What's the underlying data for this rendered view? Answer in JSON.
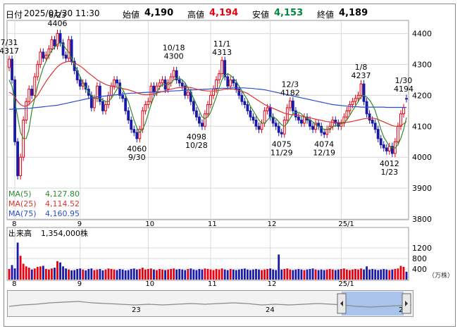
{
  "header": {
    "date_label": "日付",
    "datetime": "2025/01/30 11:30",
    "open_label": "始値",
    "open": "4,190",
    "high_label": "高値",
    "high": "4,194",
    "low_label": "安値",
    "low": "4,153",
    "close_label": "終値",
    "close": "4,189"
  },
  "legend": {
    "ma5_label": "MA(5)",
    "ma5_value": "4,127.80",
    "ma25_label": "MA(25)",
    "ma25_value": "4,114.52",
    "ma75_label": "MA(75)",
    "ma75_value": "4,160.95"
  },
  "volume_panel": {
    "title": "出来高",
    "value": "1,354,000株",
    "unit": "（万株）"
  },
  "navigator": {
    "labels": [
      "23",
      "24",
      "2"
    ]
  },
  "colors": {
    "up": "#e60012",
    "down": "#1a1aa8",
    "ma5": "#2e8b2e",
    "ma25": "#e03030",
    "ma75": "#2a4fd0",
    "grid": "#d9d9d9",
    "nav_selection": "#a9c4ea"
  },
  "chart_data": [
    {
      "type": "candlestick",
      "ylim": [
        3800,
        4440
      ],
      "yticks": [
        "4400",
        "4300",
        "4200",
        "4100",
        "4000",
        "3900",
        "3800"
      ],
      "xticks": [
        "8",
        "9",
        "10",
        "11",
        "12",
        "25/1"
      ],
      "annotations": [
        {
          "date": "7/31",
          "value": "4317"
        },
        {
          "date": "8/23",
          "value": "4406"
        },
        {
          "date": "10/18",
          "value": "4300"
        },
        {
          "date": "11/1",
          "value": "4313"
        },
        {
          "date": "12/3",
          "value": "4182"
        },
        {
          "date": "1/8",
          "value": "4237"
        },
        {
          "date": "1/30",
          "value": "4194"
        },
        {
          "date": "9/30",
          "value": "4060"
        },
        {
          "date": "10/28",
          "value": "4098"
        },
        {
          "date": "11/29",
          "value": "4075"
        },
        {
          "date": "12/19",
          "value": "4074"
        },
        {
          "date": "1/23",
          "value": "4012"
        }
      ],
      "closes": [
        4317,
        4250,
        4050,
        3940,
        4000,
        4120,
        4180,
        4220,
        4200,
        4260,
        4300,
        4340,
        4320,
        4330,
        4350,
        4380,
        4360,
        4400,
        4370,
        4330,
        4320,
        4380,
        4310,
        4280,
        4250,
        4230,
        4240,
        4220,
        4200,
        4160,
        4190,
        4230,
        4180,
        4150,
        4170,
        4200,
        4230,
        4250,
        4240,
        4200,
        4190,
        4150,
        4120,
        4090,
        4080,
        4060,
        4090,
        4150,
        4170,
        4180,
        4230,
        4210,
        4230,
        4240,
        4250,
        4220,
        4240,
        4260,
        4280,
        4250,
        4240,
        4230,
        4200,
        4210,
        4180,
        4150,
        4130,
        4110,
        4100,
        4140,
        4170,
        4200,
        4220,
        4250,
        4270,
        4313,
        4260,
        4230,
        4250,
        4240,
        4220,
        4200,
        4180,
        4170,
        4150,
        4130,
        4120,
        4100,
        4090,
        4110,
        4150,
        4160,
        4130,
        4110,
        4100,
        4080,
        4075,
        4120,
        4160,
        4182,
        4150,
        4130,
        4120,
        4110,
        4130,
        4120,
        4100,
        4090,
        4110,
        4100,
        4080,
        4074,
        4090,
        4100,
        4120,
        4110,
        4100,
        4110,
        4130,
        4150,
        4170,
        4180,
        4190,
        4200,
        4237,
        4180,
        4140,
        4120,
        4110,
        4090,
        4060,
        4040,
        4030,
        4020,
        4035,
        4012,
        4050,
        4100,
        4140,
        4160,
        4189
      ],
      "opens": [
        4290,
        4317,
        4250,
        4050,
        3940,
        4000,
        4120,
        4180,
        4220,
        4200,
        4260,
        4300,
        4340,
        4320,
        4330,
        4350,
        4380,
        4360,
        4400,
        4370,
        4330,
        4320,
        4380,
        4310,
        4280,
        4250,
        4230,
        4240,
        4220,
        4200,
        4160,
        4190,
        4230,
        4180,
        4150,
        4170,
        4200,
        4230,
        4250,
        4240,
        4200,
        4190,
        4150,
        4120,
        4090,
        4080,
        4060,
        4090,
        4150,
        4170,
        4180,
        4230,
        4210,
        4230,
        4240,
        4250,
        4220,
        4240,
        4260,
        4280,
        4250,
        4240,
        4230,
        4200,
        4210,
        4180,
        4150,
        4130,
        4110,
        4100,
        4140,
        4170,
        4200,
        4220,
        4250,
        4270,
        4313,
        4260,
        4230,
        4250,
        4240,
        4220,
        4200,
        4180,
        4170,
        4150,
        4130,
        4120,
        4100,
        4090,
        4110,
        4150,
        4160,
        4130,
        4110,
        4100,
        4080,
        4075,
        4120,
        4160,
        4182,
        4150,
        4130,
        4120,
        4110,
        4130,
        4120,
        4100,
        4090,
        4110,
        4100,
        4080,
        4074,
        4090,
        4100,
        4120,
        4110,
        4100,
        4110,
        4130,
        4150,
        4170,
        4180,
        4190,
        4200,
        4237,
        4180,
        4140,
        4120,
        4110,
        4090,
        4060,
        4040,
        4030,
        4020,
        4035,
        4012,
        4050,
        4100,
        4140,
        4190
      ],
      "ma5": [
        4250,
        4230,
        4180,
        4130,
        4080,
        4060,
        4060,
        4090,
        4150,
        4190,
        4230,
        4260,
        4290,
        4310,
        4330,
        4345,
        4355,
        4365,
        4370,
        4365,
        4350,
        4340,
        4320,
        4300,
        4280,
        4260,
        4240,
        4225,
        4210,
        4200,
        4190,
        4190,
        4190,
        4185,
        4180,
        4180,
        4190,
        4205,
        4220,
        4230,
        4220,
        4200,
        4180,
        4150,
        4120,
        4095,
        4080,
        4090,
        4110,
        4140,
        4170,
        4195,
        4210,
        4225,
        4235,
        4235,
        4235,
        4240,
        4250,
        4255,
        4255,
        4250,
        4240,
        4225,
        4210,
        4190,
        4170,
        4150,
        4130,
        4125,
        4130,
        4145,
        4170,
        4195,
        4225,
        4250,
        4265,
        4270,
        4265,
        4255,
        4245,
        4230,
        4215,
        4200,
        4185,
        4165,
        4150,
        4135,
        4120,
        4110,
        4110,
        4120,
        4130,
        4130,
        4125,
        4115,
        4105,
        4100,
        4110,
        4125,
        4140,
        4145,
        4145,
        4140,
        4130,
        4125,
        4120,
        4115,
        4105,
        4100,
        4095,
        4090,
        4090,
        4092,
        4098,
        4102,
        4105,
        4108,
        4112,
        4120,
        4135,
        4150,
        4165,
        4180,
        4195,
        4200,
        4195,
        4185,
        4170,
        4150,
        4120,
        4090,
        4065,
        4050,
        4035,
        4030,
        4030,
        4040,
        4060,
        4090,
        4128
      ],
      "ma25": [
        4210,
        4205,
        4195,
        4180,
        4170,
        4165,
        4165,
        4170,
        4180,
        4190,
        4200,
        4215,
        4230,
        4245,
        4258,
        4270,
        4282,
        4292,
        4300,
        4305,
        4308,
        4310,
        4308,
        4305,
        4300,
        4295,
        4288,
        4280,
        4272,
        4265,
        4258,
        4250,
        4245,
        4240,
        4235,
        4232,
        4230,
        4228,
        4226,
        4224,
        4222,
        4220,
        4218,
        4215,
        4212,
        4208,
        4205,
        4203,
        4202,
        4202,
        4203,
        4205,
        4207,
        4210,
        4212,
        4215,
        4218,
        4220,
        4222,
        4224,
        4225,
        4226,
        4226,
        4226,
        4225,
        4223,
        4220,
        4218,
        4216,
        4215,
        4214,
        4214,
        4214,
        4215,
        4216,
        4218,
        4220,
        4221,
        4221,
        4220,
        4218,
        4216,
        4213,
        4210,
        4206,
        4200,
        4194,
        4188,
        4182,
        4176,
        4170,
        4166,
        4162,
        4158,
        4154,
        4150,
        4146,
        4142,
        4140,
        4138,
        4137,
        4136,
        4135,
        4133,
        4131,
        4129,
        4127,
        4125,
        4123,
        4121,
        4119,
        4117,
        4115,
        4114,
        4113,
        4112,
        4112,
        4112,
        4112,
        4113,
        4114,
        4116,
        4118,
        4120,
        4122,
        4124,
        4125,
        4126,
        4126,
        4125,
        4122,
        4118,
        4114,
        4110,
        4106,
        4102,
        4100,
        4100,
        4102,
        4108,
        4115
      ],
      "ma75": [
        4155,
        4155,
        4156,
        4156,
        4157,
        4157,
        4158,
        4158,
        4159,
        4160,
        4161,
        4162,
        4163,
        4164,
        4165,
        4166,
        4167,
        4168,
        4170,
        4172,
        4174,
        4176,
        4178,
        4180,
        4182,
        4184,
        4186,
        4188,
        4190,
        4192,
        4194,
        4195,
        4196,
        4197,
        4198,
        4199,
        4200,
        4201,
        4202,
        4203,
        4204,
        4205,
        4206,
        4207,
        4207,
        4208,
        4208,
        4209,
        4209,
        4210,
        4210,
        4211,
        4211,
        4212,
        4212,
        4213,
        4213,
        4214,
        4214,
        4215,
        4215,
        4216,
        4216,
        4217,
        4217,
        4218,
        4218,
        4219,
        4219,
        4220,
        4220,
        4221,
        4221,
        4222,
        4222,
        4223,
        4223,
        4223,
        4224,
        4224,
        4224,
        4224,
        4224,
        4224,
        4223,
        4223,
        4222,
        4221,
        4220,
        4219,
        4218,
        4216,
        4214,
        4212,
        4210,
        4208,
        4206,
        4204,
        4202,
        4200,
        4198,
        4196,
        4194,
        4192,
        4190,
        4188,
        4186,
        4184,
        4182,
        4180,
        4178,
        4176,
        4174,
        4172,
        4170,
        4169,
        4168,
        4167,
        4166,
        4165,
        4164,
        4164,
        4163,
        4163,
        4162,
        4162,
        4162,
        4162,
        4162,
        4162,
        4162,
        4162,
        4162,
        4161,
        4161,
        4161,
        4161,
        4161,
        4161,
        4161,
        4161
      ]
    },
    {
      "type": "bar",
      "ylim": [
        0,
        1600
      ],
      "yticks": [
        "1200",
        "800",
        "400"
      ],
      "xticks": [
        "8",
        "9",
        "10",
        "11",
        "12",
        "25/1"
      ],
      "volumes": [
        400,
        550,
        420,
        1400,
        900,
        600,
        500,
        450,
        380,
        420,
        480,
        500,
        520,
        400,
        380,
        420,
        450,
        700,
        650,
        500,
        420,
        380,
        350,
        360,
        400,
        420,
        380,
        350,
        400,
        420,
        360,
        380,
        400,
        350,
        380,
        420,
        400,
        380,
        360,
        400,
        380,
        350,
        360,
        400,
        420,
        380,
        400,
        450,
        380,
        400,
        420,
        380,
        360,
        400,
        380,
        360,
        380,
        400,
        420,
        380,
        400,
        380,
        360,
        400,
        420,
        380,
        360,
        400,
        380,
        420,
        400,
        380,
        360,
        400,
        380,
        420,
        380,
        360,
        400,
        380,
        360,
        380,
        400,
        420,
        380,
        360,
        380,
        400,
        380,
        360,
        380,
        400,
        420,
        380,
        360,
        950,
        380,
        400,
        420,
        380,
        360,
        380,
        400,
        380,
        360,
        380,
        400,
        420,
        380,
        360,
        380,
        360,
        380,
        400,
        380,
        360,
        380,
        400,
        420,
        380,
        360,
        380,
        400,
        380,
        420,
        380,
        500,
        380,
        400,
        380,
        360,
        380,
        400,
        380,
        360,
        380,
        400,
        420,
        520,
        480,
        300
      ]
    }
  ]
}
